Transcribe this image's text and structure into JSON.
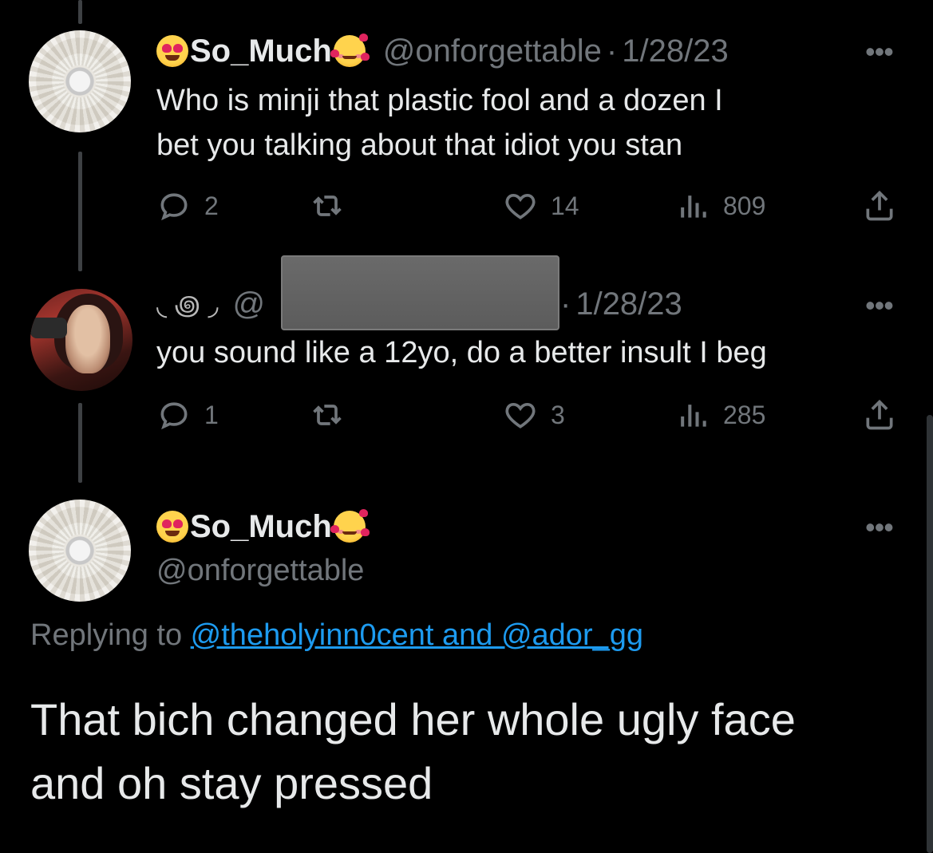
{
  "tweet1": {
    "display_name": "So_Much",
    "handle": "@onforgettable",
    "separator": "·",
    "date": "1/28/23",
    "text_line1": "Who is minji that plastic fool and a dozen I",
    "text_line2": "bet you talking about that idiot you stan",
    "replies": "2",
    "likes": "14",
    "views": "809",
    "more_label": "•••"
  },
  "tweet2": {
    "name_glyphs": "◟ ꩜ ◞",
    "handle_prefix": "@",
    "separator": "·",
    "date": "1/28/23",
    "text": "you sound like a 12yo, do a better insult I beg",
    "replies": "1",
    "likes": "3",
    "views": "285",
    "more_label": "•••"
  },
  "main_tweet": {
    "display_name": "So_Much",
    "handle": "@onforgettable",
    "replying_prefix": "Replying to ",
    "replying_to": "@theholyinn0cent and @ador_gg",
    "text_line1": "That bich changed her whole ugly face",
    "text_line2": "and oh stay pressed",
    "more_label": "•••"
  },
  "colors": {
    "background": "#000000",
    "text": "#e7e9ea",
    "muted": "#71767b",
    "link": "#1d9bf0"
  },
  "icons": [
    "reply-icon",
    "retweet-icon",
    "like-icon",
    "views-icon",
    "share-icon",
    "more-icon"
  ]
}
